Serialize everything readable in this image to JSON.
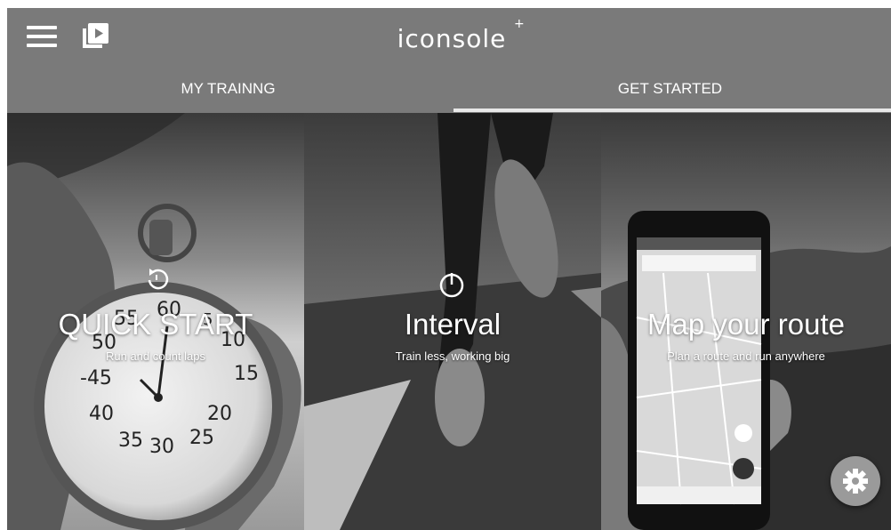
{
  "header": {
    "logo_text": "iconsole",
    "logo_plus": "+",
    "menu_icon": "hamburger-menu-icon",
    "video_icon": "video-play-icon"
  },
  "tabs": [
    {
      "label": "MY TRAINNG",
      "selected": false
    },
    {
      "label": "GET STARTED",
      "selected": true
    }
  ],
  "panels": [
    {
      "title": "QUICK START",
      "subtitle": "Run and count laps",
      "icon": "stopwatch-reset-icon"
    },
    {
      "title": "Interval",
      "subtitle": "Train less, working big",
      "icon": "power-timer-icon"
    },
    {
      "title": "Map your route",
      "subtitle": "Plan a route and run anywhere",
      "icon": ""
    }
  ],
  "fab": {
    "icon": "gear-icon"
  },
  "colors": {
    "header_bg": "#7a7a7a",
    "tab_indicator": "#e8e8e8",
    "fab_bg": "#9a9a9a"
  }
}
